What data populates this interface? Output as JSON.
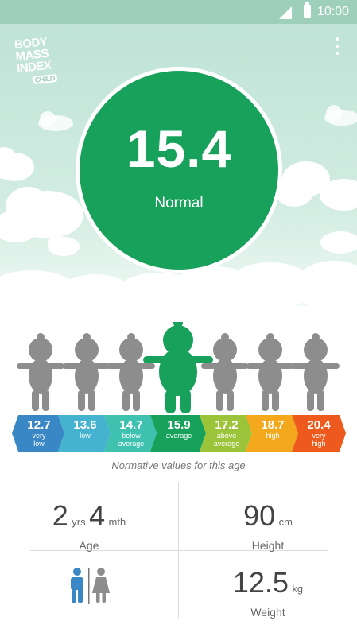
{
  "status_bar": {
    "time": "10:00"
  },
  "app": {
    "logo": {
      "line1": "BODY",
      "line2": "MASS",
      "line3": "INDEX",
      "line4": "CHILD"
    }
  },
  "result": {
    "bmi": "15.4",
    "category": "Normal",
    "accent": "#17a15b"
  },
  "scale": [
    {
      "value": "12.7",
      "label": "very low",
      "color": "#3a87c6"
    },
    {
      "value": "13.6",
      "label": "low",
      "color": "#45b3cf"
    },
    {
      "value": "14.7",
      "label": "below average",
      "color": "#3fc1b0"
    },
    {
      "value": "15.9",
      "label": "average",
      "color": "#17a15b"
    },
    {
      "value": "17.2",
      "label": "above average",
      "color": "#9cc43a"
    },
    {
      "value": "18.7",
      "label": "high",
      "color": "#f3a81d"
    },
    {
      "value": "20.4",
      "label": "very high",
      "color": "#ee5a1d"
    }
  ],
  "normative_caption": "Normative values for this age",
  "stats": {
    "age": {
      "years": "2",
      "years_unit": "yrs",
      "months": "4",
      "months_unit": "mth",
      "caption": "Age"
    },
    "height": {
      "value": "90",
      "unit": "cm",
      "caption": "Height"
    },
    "weight": {
      "value": "12.5",
      "unit": "kg",
      "caption": "Weight"
    },
    "gender": {
      "selected": "boy"
    }
  }
}
